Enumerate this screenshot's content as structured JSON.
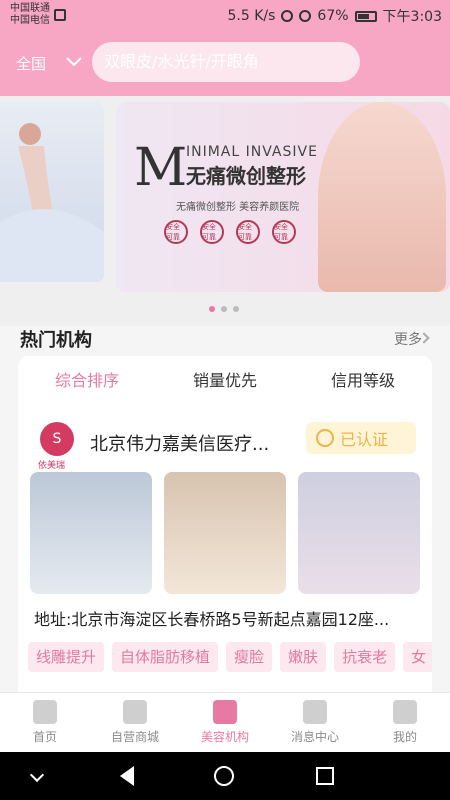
{
  "status_bar": {
    "carrier_line1": "中国联通",
    "carrier_line2": "中国电信",
    "speed": "5.5 K/s",
    "battery": "67%",
    "time": "下午3:03"
  },
  "header": {
    "region": "全国",
    "search_placeholder": "双眼皮/水光针/开眼角"
  },
  "banner": {
    "big_letter": "M",
    "english": "INIMAL INVASIVE",
    "chinese_title": "无痛微创整形",
    "subtitle": "无痛微创整形  美容养颜医院",
    "badges": [
      "安全可靠",
      "安全可靠",
      "安全可靠",
      "安全可靠"
    ]
  },
  "section": {
    "title": "热门机构",
    "more": "更多"
  },
  "tabs": [
    "综合排序",
    "销量优先",
    "信用等级"
  ],
  "org": {
    "logo_letter": "S",
    "logo_caption": "依美瑞",
    "name": "北京伟力嘉美信医疗...",
    "certified": "已认证",
    "address": "地址:北京市海淀区长春桥路5号新起点嘉园12座...",
    "tags": [
      "线雕提升",
      "自体脂肪移植",
      "瘦脸",
      "嫩肤",
      "抗衰老",
      "女"
    ]
  },
  "bottom_nav": [
    {
      "label": "首页",
      "icon": "home-icon"
    },
    {
      "label": "自营商城",
      "icon": "store-icon"
    },
    {
      "label": "美容机构",
      "icon": "medical-kit-icon"
    },
    {
      "label": "消息中心",
      "icon": "message-icon"
    },
    {
      "label": "我的",
      "icon": "user-icon"
    }
  ],
  "colors": {
    "accent": "#e77aa3",
    "header_pink": "#f7a6c4",
    "gold": "#eab54a"
  }
}
